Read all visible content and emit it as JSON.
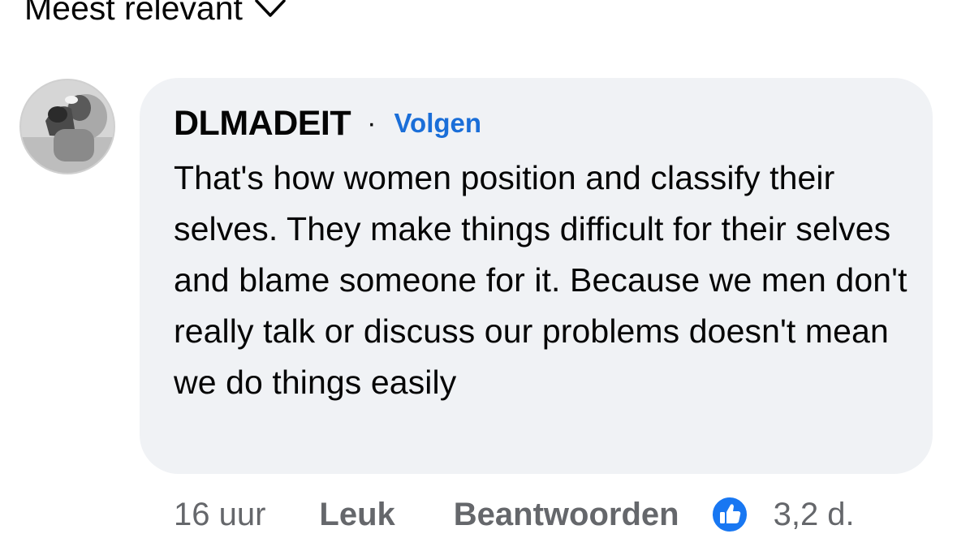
{
  "sort": {
    "label": "Meest relevant",
    "icon": "chevron-down-icon"
  },
  "comment": {
    "author": "DLMADEIT",
    "separator": "·",
    "follow_label": "Volgen",
    "text": "That's how women position and classify their selves. They make things difficult for their selves and blame someone for it. Because we men don't really talk or discuss our problems doesn't mean we do things easily",
    "time": "16 uur",
    "like_label": "Leuk",
    "reply_label": "Beantwoorden",
    "reaction_icon": "thumbs-up-icon",
    "reaction_count": "3,2 d."
  },
  "colors": {
    "bubble": "#f0f2f5",
    "link": "#1a6ed8",
    "secondary_text": "#65676b",
    "like_badge": "#1877f2"
  }
}
